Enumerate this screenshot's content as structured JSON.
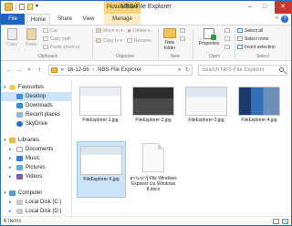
{
  "window": {
    "title": "NBS-File Explorer",
    "context_tab": "Picture Tools",
    "controls": {
      "minimize": "–",
      "maximize": "□",
      "close": "✕"
    }
  },
  "tabs": {
    "file": "File",
    "home": "Home",
    "share": "Share",
    "view": "View",
    "manage": "Manage"
  },
  "help_glyph": "?",
  "collapse_glyph": "˄",
  "ribbon": {
    "clipboard": {
      "copy": "Copy",
      "paste": "Paste",
      "cut": "Cut",
      "copy_path": "Copy path",
      "paste_shortcut": "Paste shortcut",
      "label": "Clipboard"
    },
    "organise": {
      "move_to": "Move to ▾",
      "copy_to": "Copy to ▾",
      "delete": "Delete ▾",
      "rename": "Rename",
      "label": "Organise"
    },
    "new": {
      "new_folder": "New folder",
      "label": "New"
    },
    "open": {
      "properties": "Properties",
      "label": "Open"
    },
    "select": {
      "select_all": "Select all",
      "select_none": "Select none",
      "invert_selection": "Invert selection",
      "label": "Select"
    }
  },
  "address": {
    "back": "←",
    "forward": "→",
    "recent": "▾",
    "up": "↑",
    "crumb_prefix": "«",
    "crumb1": "16-12-56",
    "crumb_sep": "›",
    "crumb2": "NBS-File Explorer",
    "dropdown": "▾",
    "refresh": "↻",
    "search_placeholder": "Search NBS-File Explorer"
  },
  "nav": {
    "favourites": "Favourites",
    "desktop": "Desktop",
    "downloads": "Downloads",
    "recent_places": "Recent places",
    "skydrive": "SkyDrive",
    "libraries": "Libraries",
    "documents": "Documents",
    "music": "Music",
    "pictures": "Pictures",
    "videos": "Videos",
    "computer": "Computer",
    "local_disk_c": "Local Disk (C:)",
    "local_disk_d": "Local Disk (D:)"
  },
  "files": [
    {
      "name": "FileExplorer-1.jpg"
    },
    {
      "name": "FileExplorer-2.jpg"
    },
    {
      "name": "FileExplorer-3.jpg"
    },
    {
      "name": "FileExplorer-4.jpg"
    },
    {
      "name": "FileExplorer-5.jpg"
    },
    {
      "name": "สาระน่ารู้ File Windows Explorer บน Windows 8.docx"
    }
  ],
  "status": {
    "count": "6 items"
  },
  "colors": {
    "accent": "#1e63c4",
    "selection": "#cce4f7",
    "context_tab": "#f6d47b",
    "close": "#c7372f"
  }
}
